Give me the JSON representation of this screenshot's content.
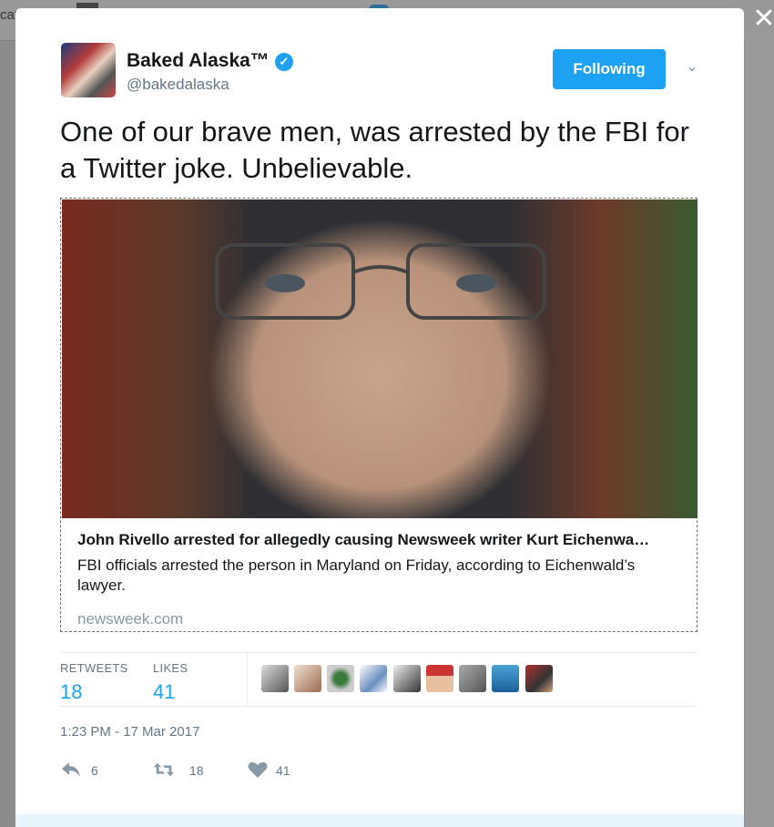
{
  "background": {
    "nav_fragment": "cat"
  },
  "tweet": {
    "author_name": "Baked Alaska™",
    "handle": "@bakedalaska",
    "follow_label": "Following",
    "text": "One of our brave men, was arrested by the FBI for a Twitter joke. Unbelievable.",
    "card": {
      "title": "John Rivello arrested for allegedly causing Newsweek writer Kurt Eichenwa…",
      "description": "FBI officials arrested the person in Maryland on Friday, according to Eichenwald’s lawyer.",
      "domain": "newsweek.com"
    },
    "stats": {
      "retweets_label": "RETWEETS",
      "retweets": "18",
      "likes_label": "LIKES",
      "likes": "41"
    },
    "timestamp": "1:23 PM - 17 Mar 2017",
    "actions": {
      "reply_count": "6",
      "retweet_count": "18",
      "like_count": "41"
    }
  },
  "colors": {
    "accent": "#1da1f2",
    "muted": "#657786",
    "text": "#14171a"
  },
  "icons": [
    "verified-badge-icon",
    "chevron-down-icon",
    "close-icon",
    "reply-icon",
    "retweet-icon",
    "heart-icon"
  ]
}
